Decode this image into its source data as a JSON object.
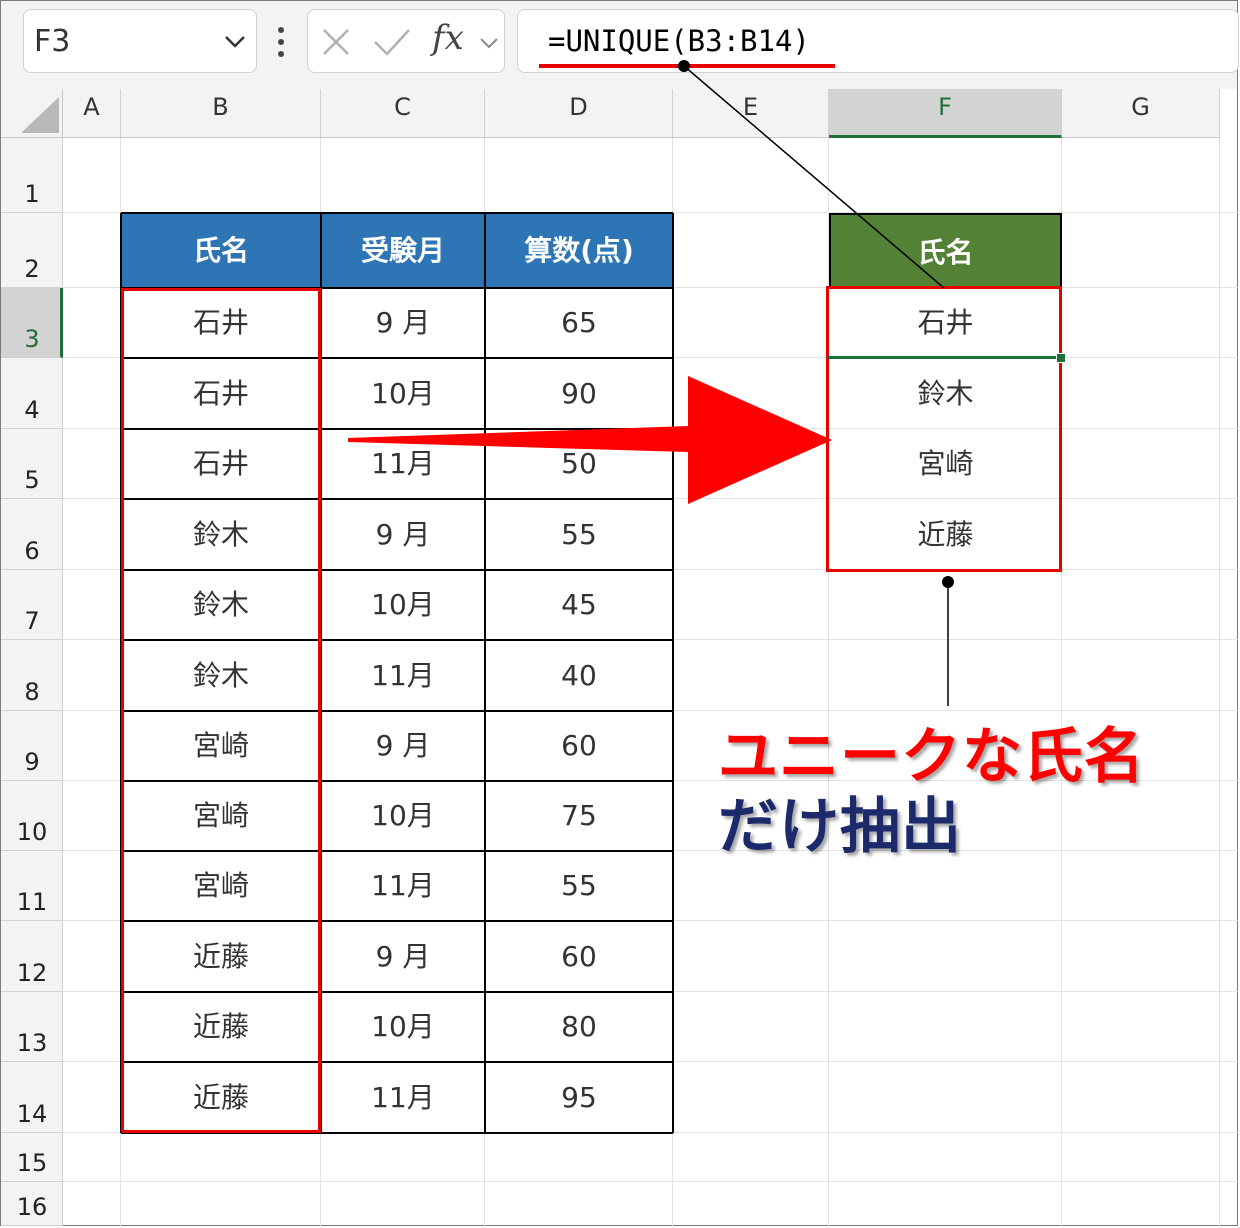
{
  "formula_bar": {
    "name_box": "F3",
    "fx": "fx",
    "formula": "=UNIQUE(B3:B14)"
  },
  "columns": [
    "A",
    "B",
    "C",
    "D",
    "E",
    "F",
    "G"
  ],
  "selected_column": "F",
  "rows": [
    "1",
    "2",
    "3",
    "4",
    "5",
    "6",
    "7",
    "8",
    "9",
    "10",
    "11",
    "12",
    "13",
    "14",
    "15",
    "16"
  ],
  "selected_row": "3",
  "source_table": {
    "headers": [
      "氏名",
      "受験月",
      "算数(点)"
    ],
    "header_color": "#2e75b6",
    "rows": [
      [
        "石井",
        "9 月",
        "65"
      ],
      [
        "石井",
        "10月",
        "90"
      ],
      [
        "石井",
        "11月",
        "50"
      ],
      [
        "鈴木",
        "9 月",
        "55"
      ],
      [
        "鈴木",
        "10月",
        "45"
      ],
      [
        "鈴木",
        "11月",
        "40"
      ],
      [
        "宮崎",
        "9 月",
        "60"
      ],
      [
        "宮崎",
        "10月",
        "75"
      ],
      [
        "宮崎",
        "11月",
        "55"
      ],
      [
        "近藤",
        "9 月",
        "60"
      ],
      [
        "近藤",
        "10月",
        "80"
      ],
      [
        "近藤",
        "11月",
        "95"
      ]
    ]
  },
  "result_table": {
    "header": "氏名",
    "header_color": "#538135",
    "values": [
      "石井",
      "鈴木",
      "宮崎",
      "近藤"
    ]
  },
  "annotation": {
    "line1": "ユニークな氏名",
    "line2": "だけ抽出",
    "line1_color": "#ff0000",
    "line2_color": "#1c2a6b",
    "highlight_color": "#e80000"
  }
}
